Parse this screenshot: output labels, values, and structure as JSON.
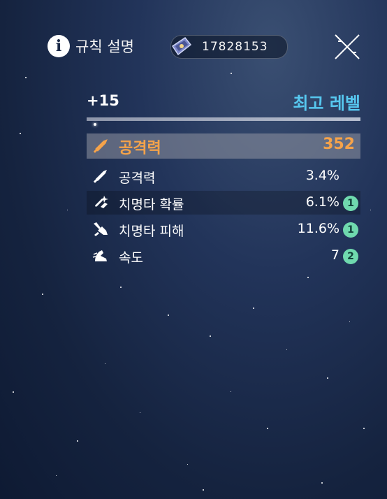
{
  "topbar": {
    "rules_label": "규칙 설명",
    "currency_amount": "17828153"
  },
  "stats": {
    "level": "+15",
    "max_level_label": "최고 레벨",
    "level_progress": 1.0,
    "main": {
      "label": "공격력",
      "value": "352",
      "icon": "sword-icon"
    },
    "substats": [
      {
        "label": "공격력",
        "value": "3.4%",
        "icon": "sword-icon",
        "rolls": ""
      },
      {
        "label": "치명타 확률",
        "value": "6.1%",
        "icon": "crit-rate-icon",
        "rolls": "1"
      },
      {
        "label": "치명타 피해",
        "value": "11.6%",
        "icon": "crit-damage-icon",
        "rolls": "1"
      },
      {
        "label": "속도",
        "value": "7",
        "icon": "speed-boot-icon",
        "rolls": "2"
      }
    ]
  },
  "colors": {
    "main_stat": "#f5a34a",
    "max_level": "#57c8f0",
    "badge": "#6fd9ae"
  }
}
